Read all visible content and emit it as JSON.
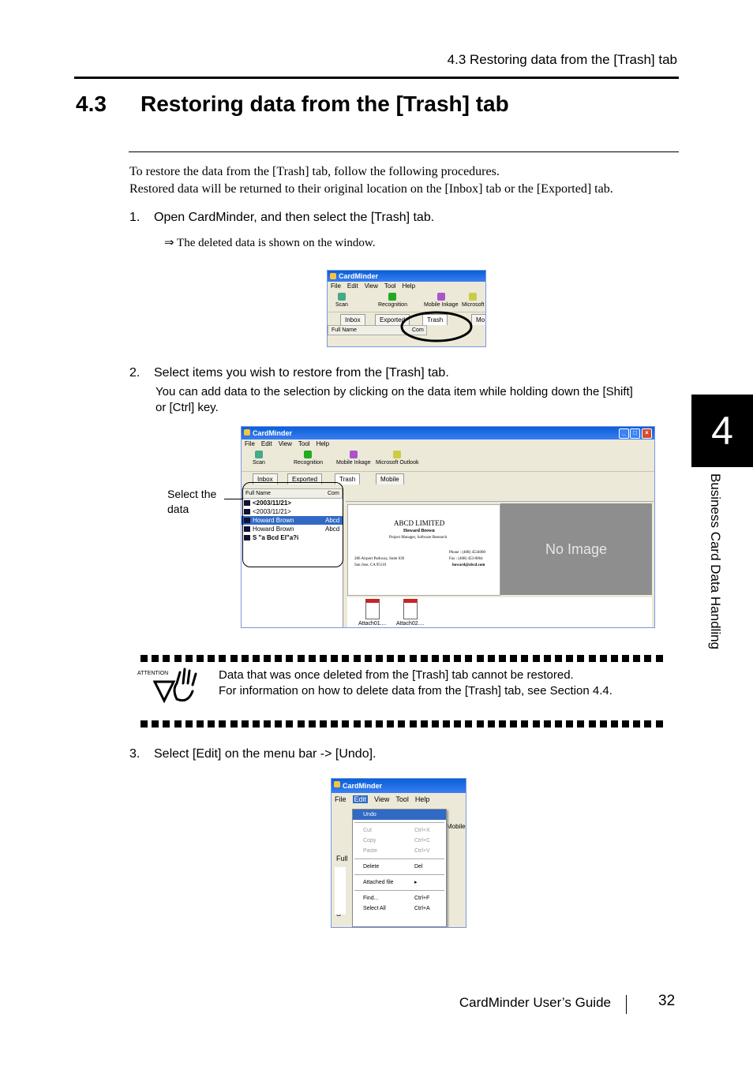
{
  "header": {
    "running_head": "4.3 Restoring data from the [Trash] tab"
  },
  "section": {
    "number": "4.3",
    "title": "Restoring data from the [Trash] tab"
  },
  "intro": {
    "line1": "To restore the data from the [Trash] tab, follow the following procedures.",
    "line2": "Restored data will be returned to their original location on the [Inbox] tab or the [Exported] tab."
  },
  "steps": [
    {
      "num": "1.",
      "text": "Open CardMinder, and then select the [Trash] tab.",
      "result": "⇒ The deleted data is shown on the window."
    },
    {
      "num": "2.",
      "text": "Select items you wish to restore from the [Trash] tab.",
      "note1": "You can add data to the selection by clicking on the data item while holding down the [Shift]",
      "note2": "or [Ctrl] key."
    },
    {
      "num": "3.",
      "text": "Select [Edit] on the menu bar -> [Undo]."
    }
  ],
  "shot1": {
    "title": "CardMinder",
    "menu": [
      "File",
      "Edit",
      "View",
      "Tool",
      "Help"
    ],
    "toolbar": [
      "Scan",
      "Recognition",
      "Mobile Inkage",
      "Microsoft"
    ],
    "tabs": [
      "Inbox",
      "Exported",
      "Trash",
      "Mo"
    ],
    "list_head": [
      "Full Name",
      "Com"
    ]
  },
  "shot2": {
    "title": "CardMinder",
    "menu": [
      "File",
      "Edit",
      "View",
      "Tool",
      "Help"
    ],
    "toolbar": [
      "Scan",
      "Recognition",
      "Mobile Inkage",
      "Microsoft Outlook"
    ],
    "tabs": [
      "Inbox",
      "Exported",
      "Trash",
      "Mobile"
    ],
    "list_head": [
      "Full Name",
      "Com"
    ],
    "rows": [
      "<2003/11/21>",
      "<2003/11/21>",
      "Howard Brown",
      "Howard Brown",
      "S \"a Bcd El\"a?i"
    ],
    "row_company": [
      "",
      "",
      "Abcd",
      "Abcd",
      ""
    ],
    "callout": "Select the data",
    "card": {
      "company": "ABCD LIMITED",
      "name": "Howard Brown",
      "role": "Project Manager, Software Research",
      "address1": "286 Airport Parkway, Suite 630",
      "address2": "San Jose, CA 95110",
      "phone": "Phone : (408) 4534000",
      "fax": "Fax : (408) 453-0064",
      "email": "howard@abcd.com"
    },
    "no_image": "No Image",
    "attachments": [
      "Attach01....",
      "Attach02...."
    ]
  },
  "attention": {
    "label": "ATTENTION",
    "line1": "Data that was once deleted from the [Trash] tab cannot be restored.",
    "line2": "For information on how to delete data from the [Trash] tab, see Section 4.4."
  },
  "shot3": {
    "title": "CardMinder",
    "menu": [
      "File",
      "Edit",
      "View",
      "Tool",
      "Help"
    ],
    "dropdown": [
      {
        "label": "Undo",
        "key": ""
      },
      {
        "label": "Cut",
        "key": "Ctrl+X"
      },
      {
        "label": "Copy",
        "key": "Ctrl+C"
      },
      {
        "label": "Paste",
        "key": "Ctrl+V"
      },
      {
        "label": "Delete",
        "key": "Del"
      },
      {
        "label": "Attached file",
        "key": "▸"
      },
      {
        "label": "Find...",
        "key": "Ctrl+F"
      },
      {
        "label": "Select All",
        "key": "Ctrl+A"
      }
    ],
    "side_fragments": [
      "Mobile",
      "Full",
      "S"
    ]
  },
  "side_tab": {
    "chapter": "4",
    "label": "Business Card Data Handling"
  },
  "footer": {
    "guide": "CardMinder  User’s Guide",
    "page": "32"
  },
  "colors": {
    "xp_blue": "#0a5fd8",
    "selection": "#316ac5",
    "no_image_bg": "#8e8e8e"
  }
}
